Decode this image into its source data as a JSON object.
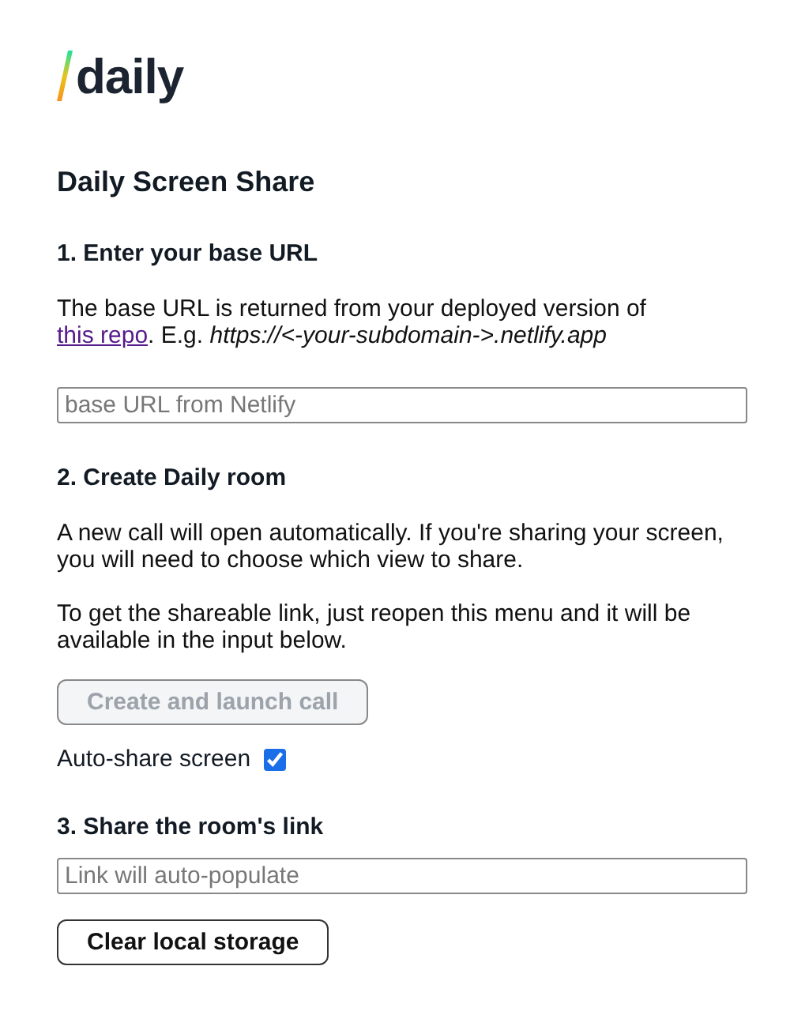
{
  "logo": {
    "text": "daily"
  },
  "title": "Daily Screen Share",
  "sections": [
    {
      "heading": "1. Enter your base URL",
      "paragraphs": [
        {
          "before": "The base URL is returned from your deployed version of ",
          "link": "this repo",
          "after": ". E.g. *https://<-your-subdomain->.netlify.app*"
        }
      ],
      "field": {
        "placeholder": "base URL from Netlify"
      }
    },
    {
      "heading": "2. Create Daily room",
      "paragraphs": [
        {
          "before": "A new call will open automatically. If you're sharing your screen, you will need to choose which view to share."
        },
        {
          "before": "To get the shareable link, just reopen this menu and it will be available in the input below."
        }
      ],
      "button": {
        "label": "Create and launch call",
        "disabled": true
      },
      "checkbox": {
        "label": "Auto-share screen",
        "checked": true
      }
    },
    {
      "heading": "3. Share the room's link",
      "field": {
        "placeholder": "Link will auto-populate"
      },
      "button": {
        "label": "Clear local storage",
        "disabled": false
      }
    }
  ]
}
